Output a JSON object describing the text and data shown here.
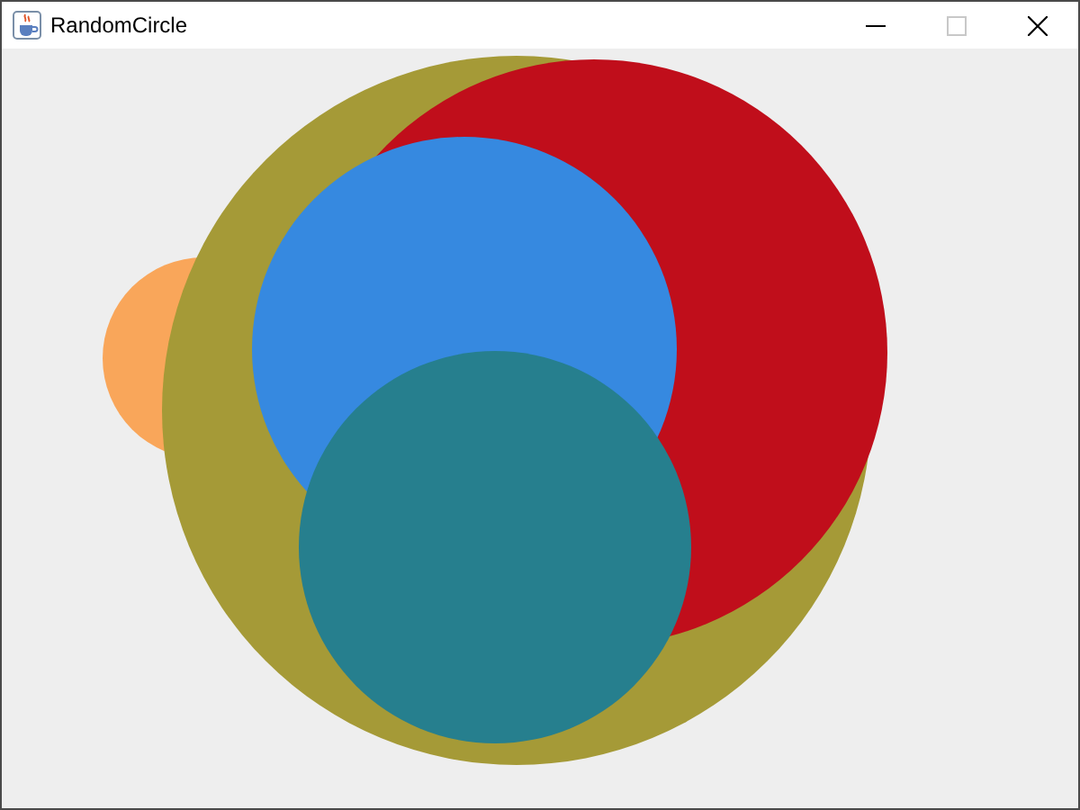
{
  "window": {
    "title": "RandomCircle",
    "controls": [
      {
        "kind": "minimize",
        "disabled": false
      },
      {
        "kind": "maximize",
        "disabled": true
      },
      {
        "kind": "close",
        "disabled": false
      }
    ]
  },
  "circles": [
    {
      "color": "#f9a65a"
    },
    {
      "color": "#a59a37"
    },
    {
      "color": "#c00e1b"
    },
    {
      "color": "#3689e0"
    },
    {
      "color": "#267f8e"
    }
  ]
}
